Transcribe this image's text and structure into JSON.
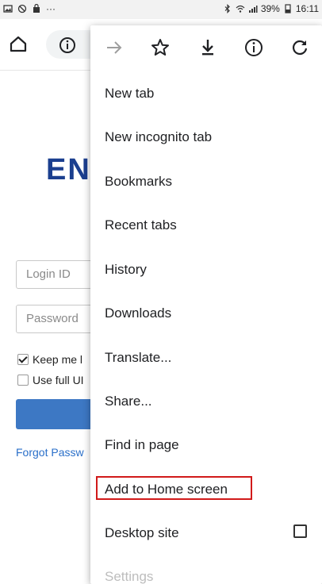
{
  "status_bar": {
    "more": "···",
    "battery": "39%",
    "time": "16:11"
  },
  "page": {
    "logo_partial": "EN",
    "login_placeholder": "Login ID",
    "password_placeholder": "Password",
    "keep_me": "Keep me l",
    "use_full": "Use full UI",
    "forgot": "Forgot Passw"
  },
  "menu": {
    "toolbar_icons": [
      "forward-arrow-icon",
      "star-icon",
      "download-icon",
      "info-icon",
      "refresh-icon"
    ],
    "items": [
      {
        "label": "New tab"
      },
      {
        "label": "New incognito tab"
      },
      {
        "label": "Bookmarks"
      },
      {
        "label": "Recent tabs"
      },
      {
        "label": "History"
      },
      {
        "label": "Downloads"
      },
      {
        "label": "Translate..."
      },
      {
        "label": "Share..."
      },
      {
        "label": "Find in page"
      },
      {
        "label": "Add to Home screen"
      },
      {
        "label": "Desktop site"
      },
      {
        "label": "Settings"
      }
    ],
    "highlight_color": "#d11a1a"
  }
}
